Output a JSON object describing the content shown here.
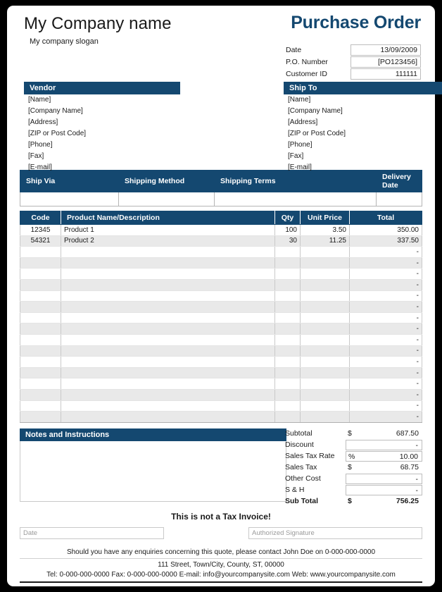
{
  "header": {
    "company_name": "My Company name",
    "company_slogan": "My company slogan",
    "doc_title": "Purchase Order",
    "meta": [
      {
        "label": "Date",
        "value": "13/09/2009"
      },
      {
        "label": "P.O. Number",
        "value": "[PO123456]"
      },
      {
        "label": "Customer ID",
        "value": "111111"
      }
    ]
  },
  "vendor": {
    "title": "Vendor",
    "lines": [
      "[Name]",
      "[Company Name]",
      "[Address]",
      "[ZIP or Post Code]",
      "[Phone]",
      "[Fax]",
      "[E-mail]"
    ]
  },
  "ship_to": {
    "title": "Ship To",
    "lines": [
      "[Name]",
      "[Company Name]",
      "[Address]",
      "[ZIP or Post Code]",
      "[Phone]",
      "[Fax]",
      "[E-mail]"
    ]
  },
  "shipping": {
    "columns": [
      "Ship Via",
      "Shipping Method",
      "Shipping Terms",
      "Delivery Date"
    ],
    "values": [
      "",
      "",
      "",
      ""
    ]
  },
  "items": {
    "columns": [
      "Code",
      "Product Name/Description",
      "Qty",
      "Unit Price",
      "Total"
    ],
    "rows": [
      {
        "code": "12345",
        "desc": "Product 1",
        "qty": "100",
        "price": "3.50",
        "total": "350.00"
      },
      {
        "code": "54321",
        "desc": "Product 2",
        "qty": "30",
        "price": "11.25",
        "total": "337.50"
      },
      {
        "code": "",
        "desc": "",
        "qty": "",
        "price": "",
        "total": "-"
      },
      {
        "code": "",
        "desc": "",
        "qty": "",
        "price": "",
        "total": "-"
      },
      {
        "code": "",
        "desc": "",
        "qty": "",
        "price": "",
        "total": "-"
      },
      {
        "code": "",
        "desc": "",
        "qty": "",
        "price": "",
        "total": "-"
      },
      {
        "code": "",
        "desc": "",
        "qty": "",
        "price": "",
        "total": "-"
      },
      {
        "code": "",
        "desc": "",
        "qty": "",
        "price": "",
        "total": "-"
      },
      {
        "code": "",
        "desc": "",
        "qty": "",
        "price": "",
        "total": "-"
      },
      {
        "code": "",
        "desc": "",
        "qty": "",
        "price": "",
        "total": "-"
      },
      {
        "code": "",
        "desc": "",
        "qty": "",
        "price": "",
        "total": "-"
      },
      {
        "code": "",
        "desc": "",
        "qty": "",
        "price": "",
        "total": "-"
      },
      {
        "code": "",
        "desc": "",
        "qty": "",
        "price": "",
        "total": "-"
      },
      {
        "code": "",
        "desc": "",
        "qty": "",
        "price": "",
        "total": "-"
      },
      {
        "code": "",
        "desc": "",
        "qty": "",
        "price": "",
        "total": "-"
      },
      {
        "code": "",
        "desc": "",
        "qty": "",
        "price": "",
        "total": "-"
      },
      {
        "code": "",
        "desc": "",
        "qty": "",
        "price": "",
        "total": "-"
      },
      {
        "code": "",
        "desc": "",
        "qty": "",
        "price": "",
        "total": "-"
      }
    ]
  },
  "notes": {
    "title": "Notes and Instructions",
    "body": ""
  },
  "totals": [
    {
      "label": "Subtotal",
      "symbol": "$",
      "amount": "687.50",
      "boxed": false,
      "bold": false
    },
    {
      "label": "Discount",
      "symbol": "",
      "amount": "-",
      "boxed": true,
      "bold": false
    },
    {
      "label": "Sales Tax Rate",
      "symbol": "%",
      "amount": "10.00",
      "boxed": true,
      "bold": false
    },
    {
      "label": "Sales Tax",
      "symbol": "$",
      "amount": "68.75",
      "boxed": false,
      "bold": false
    },
    {
      "label": "Other Cost",
      "symbol": "",
      "amount": "-",
      "boxed": true,
      "bold": false
    },
    {
      "label": "S & H",
      "symbol": "",
      "amount": "-",
      "boxed": true,
      "bold": false
    },
    {
      "label": "Sub Total",
      "symbol": "$",
      "amount": "756.25",
      "boxed": false,
      "bold": true
    }
  ],
  "signature": {
    "notice": "This is not a Tax Invoice!",
    "date_placeholder": "Date",
    "auth_placeholder": "Authorized Signature",
    "date_value": "",
    "auth_value": ""
  },
  "footer": {
    "enquiry": "Should you have any enquiries concerning this quote, please contact John Doe on 0-000-000-0000",
    "address": "111 Street, Town/City, County, ST, 00000",
    "contact": "Tel: 0-000-000-0000 Fax: 0-000-000-0000 E-mail: info@yourcompanysite.com Web: www.yourcompanysite.com"
  },
  "colors": {
    "navy": "#144870",
    "stripe": "#e9e9e9",
    "border": "#c9c9c9",
    "page_background": "#000000"
  }
}
